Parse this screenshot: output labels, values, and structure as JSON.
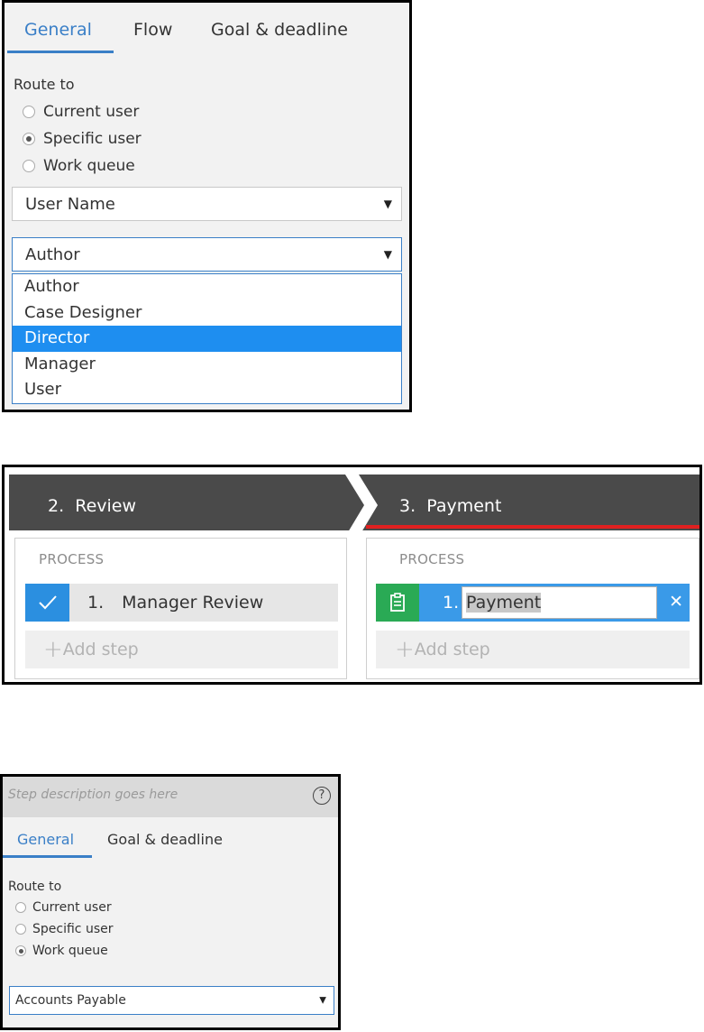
{
  "panel1": {
    "tabs": [
      "General",
      "Flow",
      "Goal & deadline"
    ],
    "route_to_label": "Route to",
    "radio_options": [
      "Current user",
      "Specific user",
      "Work queue"
    ],
    "radio_selected": "Specific user",
    "select_type": "User Name",
    "select_value": "Author",
    "dropdown_options": [
      "Author",
      "Case Designer",
      "Director",
      "Manager",
      "User"
    ],
    "dropdown_highlighted": "Director"
  },
  "panel2": {
    "stages": [
      {
        "number": "2.",
        "title": "Review"
      },
      {
        "number": "3.",
        "title": "Payment"
      }
    ],
    "process_label": "PROCESS",
    "review_step": {
      "number": "1.",
      "name": "Manager Review"
    },
    "payment_step": {
      "number": "1.",
      "name": "Payment"
    },
    "add_step_label": "Add step",
    "colors": {
      "stage_bg": "#4a4a4a",
      "active_stage_underline": "#e02020",
      "step_check_bg": "#2b8fe0",
      "step_form_bg": "#2aaa55"
    }
  },
  "panel3": {
    "description_placeholder": "Step description goes here",
    "help_symbol": "?",
    "tabs": [
      "General",
      "Goal & deadline"
    ],
    "route_to_label": "Route to",
    "radio_options": [
      "Current user",
      "Specific user",
      "Work queue"
    ],
    "radio_selected": "Work queue",
    "select_value": "Accounts Payable"
  }
}
